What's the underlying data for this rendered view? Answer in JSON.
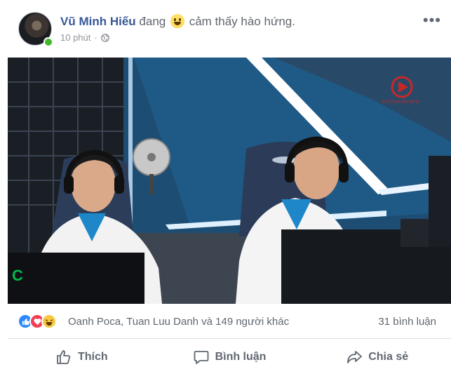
{
  "post": {
    "author": "Vũ Minh Hiếu",
    "activity_prefix": "đang",
    "feeling_emoji": "grinning-face-emoji",
    "activity_suffix": "cảm thấy hào hứng.",
    "time": "10 phút",
    "separator": "·",
    "privacy_icon": "globe-icon",
    "more_icon": "more-options-icon",
    "online_color": "#42b72a"
  },
  "photo": {
    "watermark": "PLAYCHUẨN.INFO",
    "monitor_letter": "C"
  },
  "reactions": {
    "icons": [
      "like-icon",
      "love-icon",
      "haha-icon"
    ],
    "summary": "Oanh Poca, Tuan Luu Danh và 149 người khác",
    "comments": "31 bình luận"
  },
  "actions": {
    "like": "Thích",
    "comment": "Bình luận",
    "share": "Chia sẻ"
  },
  "colors": {
    "author": "#385898",
    "secondary_text": "#606770",
    "like": "#2d88ff",
    "love": "#f33e58",
    "haha": "#f7c843"
  }
}
